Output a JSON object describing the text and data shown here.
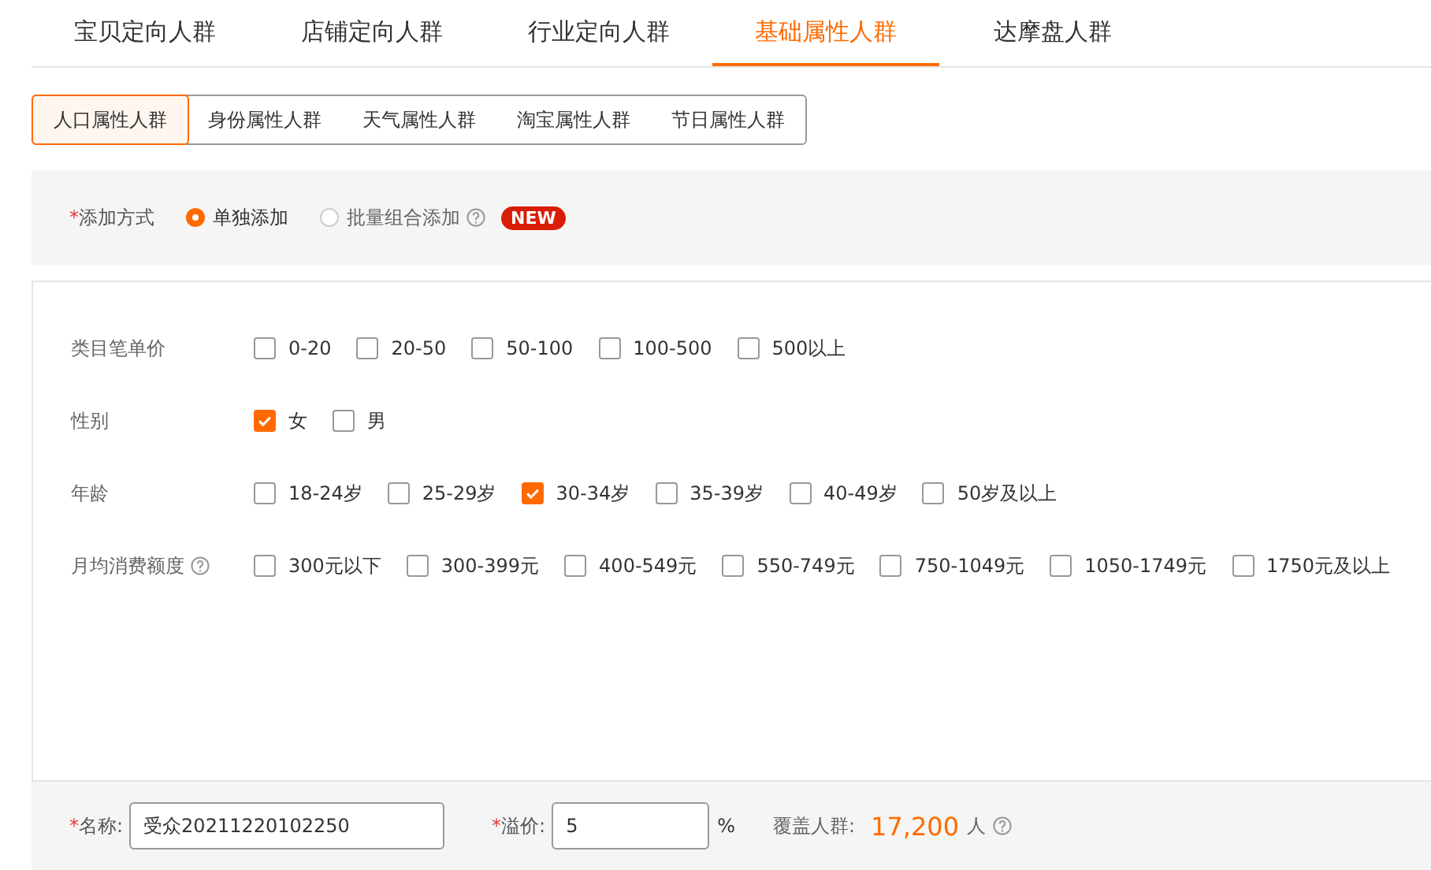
{
  "tabs": [
    {
      "label": "宝贝定向人群",
      "selected": false
    },
    {
      "label": "店铺定向人群",
      "selected": false
    },
    {
      "label": "行业定向人群",
      "selected": false
    },
    {
      "label": "基础属性人群",
      "selected": true
    },
    {
      "label": "达摩盘人群",
      "selected": false
    }
  ],
  "subtabs": [
    {
      "label": "人口属性人群",
      "selected": true
    },
    {
      "label": "身份属性人群",
      "selected": false
    },
    {
      "label": "天气属性人群",
      "selected": false
    },
    {
      "label": "淘宝属性人群",
      "selected": false
    },
    {
      "label": "节日属性人群",
      "selected": false
    }
  ],
  "add_method": {
    "mark": "*",
    "label": "添加方式",
    "options": [
      {
        "label": "单独添加",
        "selected": true
      },
      {
        "label": "批量组合添加",
        "selected": false,
        "help": true,
        "badge": "NEW"
      }
    ]
  },
  "filters": [
    {
      "label": "类目笔单价",
      "options": [
        {
          "label": "0-20",
          "checked": false
        },
        {
          "label": "20-50",
          "checked": false
        },
        {
          "label": "50-100",
          "checked": false
        },
        {
          "label": "100-500",
          "checked": false
        },
        {
          "label": "500以上",
          "checked": false
        }
      ]
    },
    {
      "label": "性别",
      "options": [
        {
          "label": "女",
          "checked": true
        },
        {
          "label": "男",
          "checked": false
        }
      ]
    },
    {
      "label": "年龄",
      "options": [
        {
          "label": "18-24岁",
          "checked": false
        },
        {
          "label": "25-29岁",
          "checked": false
        },
        {
          "label": "30-34岁",
          "checked": true
        },
        {
          "label": "35-39岁",
          "checked": false
        },
        {
          "label": "40-49岁",
          "checked": false
        },
        {
          "label": "50岁及以上",
          "checked": false
        }
      ]
    },
    {
      "label": "月均消费额度",
      "help": true,
      "options": [
        {
          "label": "300元以下",
          "checked": false
        },
        {
          "label": "300-399元",
          "checked": false
        },
        {
          "label": "400-549元",
          "checked": false
        },
        {
          "label": "550-749元",
          "checked": false
        },
        {
          "label": "750-1049元",
          "checked": false
        },
        {
          "label": "1050-1749元",
          "checked": false
        },
        {
          "label": "1750元及以上",
          "checked": false
        }
      ]
    }
  ],
  "footer": {
    "name": {
      "mark": "*",
      "label": "名称:",
      "value": "受众20211220102250"
    },
    "premium": {
      "mark": "*",
      "label": "溢价:",
      "value": "5",
      "unit": "%"
    },
    "coverage": {
      "label": "覆盖人群:",
      "value": "17,200",
      "unit": "人"
    }
  }
}
